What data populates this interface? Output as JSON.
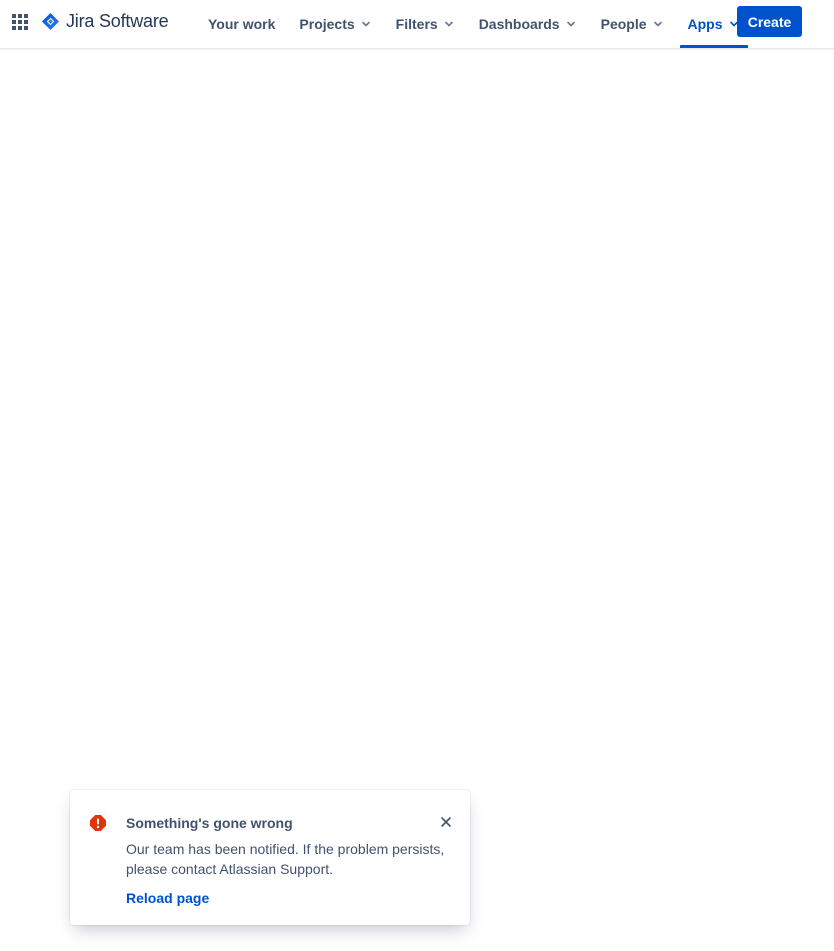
{
  "topbar": {
    "app_switcher_icon": "grid-icon",
    "logo": {
      "icon": "jira-diamond-icon",
      "text": "Jira Software",
      "color": "#2684ff"
    },
    "nav_items": [
      {
        "label": "Your work",
        "has_dropdown": false,
        "active": false
      },
      {
        "label": "Projects",
        "has_dropdown": true,
        "active": false
      },
      {
        "label": "Filters",
        "has_dropdown": true,
        "active": false
      },
      {
        "label": "Dashboards",
        "has_dropdown": true,
        "active": false
      },
      {
        "label": "People",
        "has_dropdown": true,
        "active": false
      },
      {
        "label": "Apps",
        "has_dropdown": true,
        "active": true
      }
    ],
    "create_label": "Create"
  },
  "flag": {
    "icon": "error-icon",
    "icon_color": "#de350b",
    "title": "Something's gone wrong",
    "body": "Our team has been notified. If the problem persists, please contact Atlassian Support.",
    "action_label": "Reload page",
    "close_icon": "close-icon"
  },
  "colors": {
    "accent": "#0052cc",
    "nav_text": "#42526e"
  }
}
